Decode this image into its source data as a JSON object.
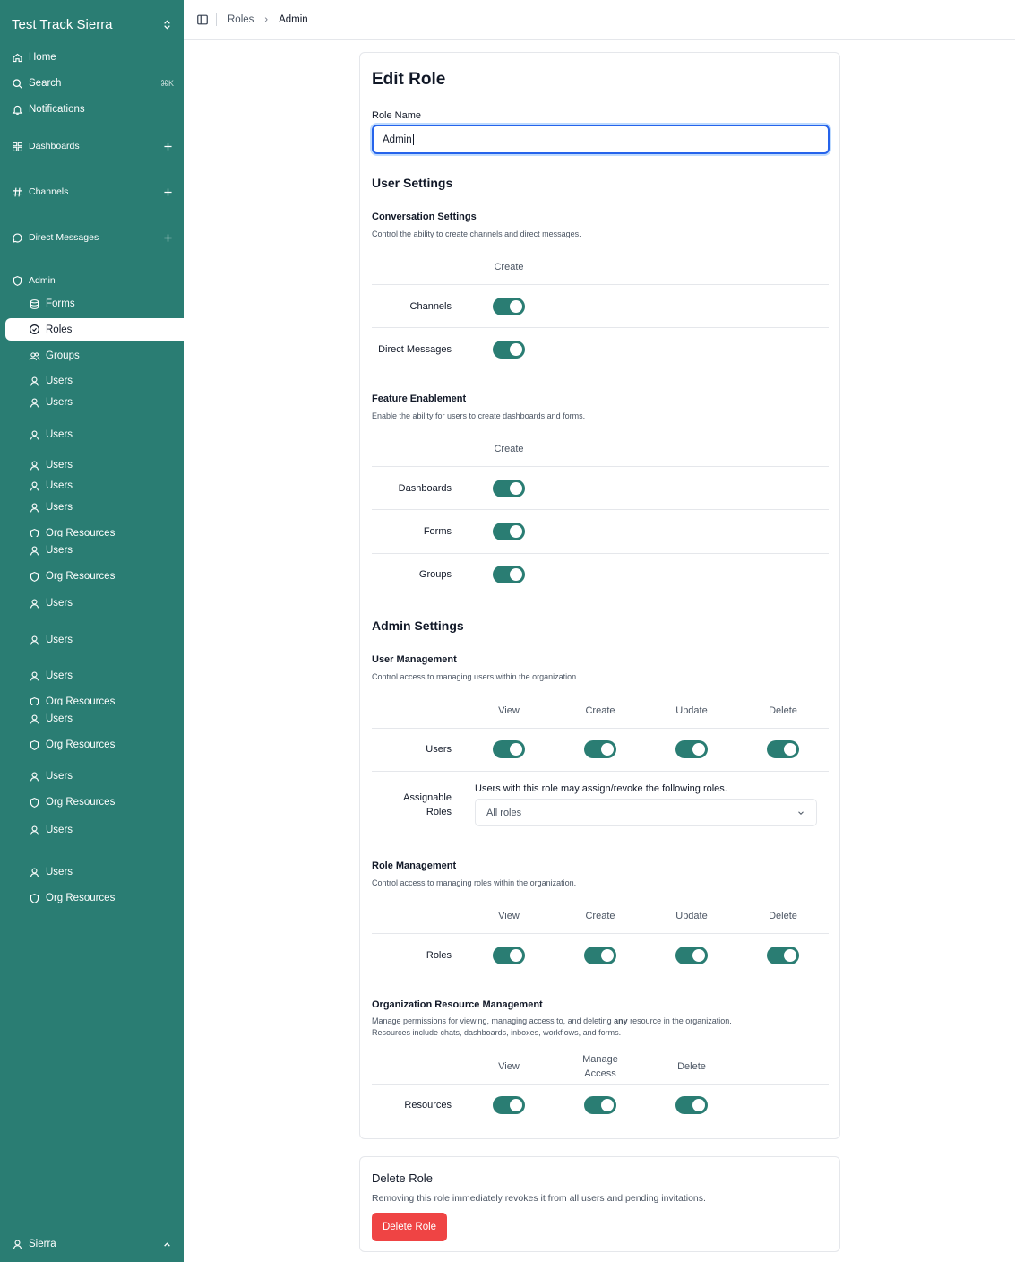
{
  "sidebar": {
    "workspace": "Test Track Sierra",
    "nav": {
      "home": "Home",
      "search": "Search",
      "search_shortcut": "⌘K",
      "notifications": "Notifications",
      "dashboards": "Dashboards",
      "channels": "Channels",
      "direct_messages": "Direct Messages",
      "admin": "Admin"
    },
    "admin_items": {
      "forms": "Forms",
      "roles": "Roles",
      "groups": "Groups",
      "users": "Users",
      "org_resources": "Org Resources"
    },
    "footer_user": "Sierra"
  },
  "breadcrumb": {
    "parent": "Roles",
    "current": "Admin"
  },
  "form": {
    "title": "Edit Role",
    "role_name_label": "Role Name",
    "role_name_value": "Admin",
    "user_settings": {
      "heading": "User Settings",
      "conversation": {
        "title": "Conversation Settings",
        "description": "Control the ability to create channels and direct messages.",
        "column": "Create",
        "rows": [
          {
            "label": "Channels",
            "create": true
          },
          {
            "label": "Direct Messages",
            "create": true
          }
        ]
      },
      "features": {
        "title": "Feature Enablement",
        "description": "Enable the ability for users to create dashboards and forms.",
        "column": "Create",
        "rows": [
          {
            "label": "Dashboards",
            "create": true
          },
          {
            "label": "Forms",
            "create": true
          },
          {
            "label": "Groups",
            "create": true
          }
        ]
      }
    },
    "admin_settings": {
      "heading": "Admin Settings",
      "user_management": {
        "title": "User Management",
        "description": "Control access to managing users within the organization.",
        "columns": [
          "View",
          "Create",
          "Update",
          "Delete"
        ],
        "row_label": "Users",
        "values": [
          true,
          true,
          true,
          true
        ],
        "assignable_label_1": "Assignable",
        "assignable_label_2": "Roles",
        "assignable_text": "Users with this role may assign/revoke the following roles.",
        "assignable_value": "All roles"
      },
      "role_management": {
        "title": "Role Management",
        "description": "Control access to managing roles within the organization.",
        "columns": [
          "View",
          "Create",
          "Update",
          "Delete"
        ],
        "row_label": "Roles",
        "values": [
          true,
          true,
          true,
          true
        ]
      },
      "resource_management": {
        "title": "Organization Resource Management",
        "description_1a": "Manage permissions for viewing, managing access to, and deleting ",
        "description_1b": "any",
        "description_1c": " resource in the organization.",
        "description_2": "Resources include chats, dashboards, inboxes, workflows, and forms.",
        "col_view": "View",
        "col_manage_1": "Manage",
        "col_manage_2": "Access",
        "col_delete": "Delete",
        "row_label": "Resources",
        "values": [
          true,
          true,
          true
        ]
      }
    }
  },
  "delete_role": {
    "title": "Delete Role",
    "description": "Removing this role immediately revokes it from all users and pending invitations.",
    "button": "Delete Role"
  },
  "colors": {
    "sidebar": "#2a7d73",
    "toggle_on": "#2a7d73",
    "danger": "#ef4444",
    "focus": "#2563eb"
  }
}
